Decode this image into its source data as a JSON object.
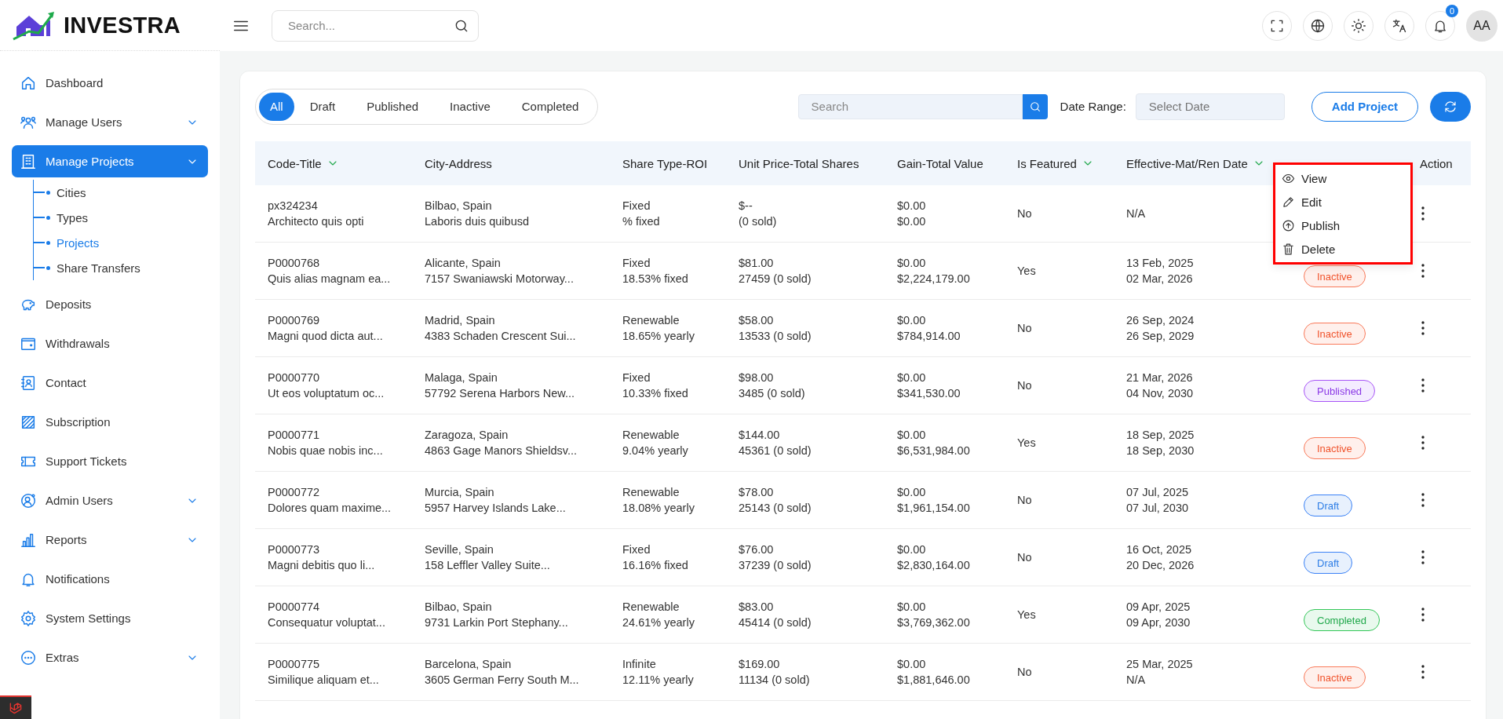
{
  "header": {
    "brand": "INVESTRA",
    "search": {
      "placeholder": "Search..."
    },
    "notifications_count": "0",
    "avatar": "AA"
  },
  "sidebar": {
    "items": [
      {
        "label": "Dashboard",
        "selected": false,
        "has_submenu": false
      },
      {
        "label": "Manage Users",
        "selected": false,
        "has_submenu": true
      },
      {
        "label": "Manage Projects",
        "selected": true,
        "has_submenu": true,
        "children": [
          {
            "label": "Cities",
            "selected": false
          },
          {
            "label": "Types",
            "selected": false
          },
          {
            "label": "Projects",
            "selected": true
          },
          {
            "label": "Share Transfers",
            "selected": false
          }
        ]
      },
      {
        "label": "Deposits",
        "selected": false,
        "has_submenu": false
      },
      {
        "label": "Withdrawals",
        "selected": false,
        "has_submenu": false
      },
      {
        "label": "Contact",
        "selected": false,
        "has_submenu": false
      },
      {
        "label": "Subscription",
        "selected": false,
        "has_submenu": false
      },
      {
        "label": "Support Tickets",
        "selected": false,
        "has_submenu": false
      },
      {
        "label": "Admin Users",
        "selected": false,
        "has_submenu": true
      },
      {
        "label": "Reports",
        "selected": false,
        "has_submenu": true
      },
      {
        "label": "Notifications",
        "selected": false,
        "has_submenu": false
      },
      {
        "label": "System Settings",
        "selected": false,
        "has_submenu": false
      },
      {
        "label": "Extras",
        "selected": false,
        "has_submenu": true
      }
    ]
  },
  "toolbar": {
    "tabs": [
      {
        "label": "All",
        "selected": true
      },
      {
        "label": "Draft",
        "selected": false
      },
      {
        "label": "Published",
        "selected": false
      },
      {
        "label": "Inactive",
        "selected": false
      },
      {
        "label": "Completed",
        "selected": false
      }
    ],
    "search": {
      "placeholder": "Search"
    },
    "date_range_label": "Date Range:",
    "date": {
      "placeholder": "Select Date"
    },
    "add_button": "Add Project"
  },
  "table": {
    "columns": [
      {
        "label": "Code-Title",
        "sortable": true
      },
      {
        "label": "City-Address",
        "sortable": false
      },
      {
        "label": "Share Type-ROI",
        "sortable": false
      },
      {
        "label": "Unit Price-Total Shares",
        "sortable": false
      },
      {
        "label": "Gain-Total Value",
        "sortable": false
      },
      {
        "label": "Is Featured",
        "sortable": true
      },
      {
        "label": "Effective-Mat/Ren Date",
        "sortable": true
      },
      {
        "label": "Action",
        "sortable": false
      }
    ],
    "rows": [
      {
        "cells": [
          [
            "px324234",
            "Architecto quis opti"
          ],
          [
            "Bilbao, Spain",
            "Laboris duis quibusd"
          ],
          [
            "Fixed",
            "% fixed"
          ],
          [
            "$--",
            "(0 sold)"
          ],
          [
            "$0.00",
            "$0.00"
          ],
          [
            "No"
          ],
          [
            "N/A"
          ]
        ]
      },
      {
        "cells": [
          [
            "P0000768",
            "Quis alias magnam ea..."
          ],
          [
            "Alicante, Spain",
            "7157 Swaniawski Motorway..."
          ],
          [
            "Fixed",
            "18.53% fixed"
          ],
          [
            "$81.00",
            "27459 (0 sold)"
          ],
          [
            "$0.00",
            "$2,224,179.00"
          ],
          [
            "Yes"
          ],
          [
            "13 Feb, 2025",
            "02 Mar, 2026"
          ]
        ],
        "status": {
          "label": "Inactive",
          "kind": "inactive"
        }
      },
      {
        "cells": [
          [
            "P0000769",
            "Magni quod dicta aut..."
          ],
          [
            "Madrid, Spain",
            "4383 Schaden Crescent Sui..."
          ],
          [
            "Renewable",
            "18.65% yearly"
          ],
          [
            "$58.00",
            "13533 (0 sold)"
          ],
          [
            "$0.00",
            "$784,914.00"
          ],
          [
            "No"
          ],
          [
            "26 Sep, 2024",
            "26 Sep, 2029"
          ]
        ],
        "status": {
          "label": "Inactive",
          "kind": "inactive"
        }
      },
      {
        "cells": [
          [
            "P0000770",
            "Ut eos voluptatum oc..."
          ],
          [
            "Malaga, Spain",
            "57792 Serena Harbors New..."
          ],
          [
            "Fixed",
            "10.33% fixed"
          ],
          [
            "$98.00",
            "3485 (0 sold)"
          ],
          [
            "$0.00",
            "$341,530.00"
          ],
          [
            "No"
          ],
          [
            "21 Mar, 2026",
            "04 Nov, 2030"
          ]
        ],
        "status": {
          "label": "Published",
          "kind": "published"
        }
      },
      {
        "cells": [
          [
            "P0000771",
            "Nobis quae nobis inc..."
          ],
          [
            "Zaragoza, Spain",
            "4863 Gage Manors Shieldsv..."
          ],
          [
            "Renewable",
            "9.04% yearly"
          ],
          [
            "$144.00",
            "45361 (0 sold)"
          ],
          [
            "$0.00",
            "$6,531,984.00"
          ],
          [
            "Yes"
          ],
          [
            "18 Sep, 2025",
            "18 Sep, 2030"
          ]
        ],
        "status": {
          "label": "Inactive",
          "kind": "inactive"
        }
      },
      {
        "cells": [
          [
            "P0000772",
            "Dolores quam maxime..."
          ],
          [
            "Murcia, Spain",
            "5957 Harvey Islands Lake..."
          ],
          [
            "Renewable",
            "18.08% yearly"
          ],
          [
            "$78.00",
            "25143 (0 sold)"
          ],
          [
            "$0.00",
            "$1,961,154.00"
          ],
          [
            "No"
          ],
          [
            "07 Jul, 2025",
            "07 Jul, 2030"
          ]
        ],
        "status": {
          "label": "Draft",
          "kind": "draft"
        }
      },
      {
        "cells": [
          [
            "P0000773",
            "Magni debitis quo li..."
          ],
          [
            "Seville, Spain",
            "158 Leffler Valley Suite..."
          ],
          [
            "Fixed",
            "16.16% fixed"
          ],
          [
            "$76.00",
            "37239 (0 sold)"
          ],
          [
            "$0.00",
            "$2,830,164.00"
          ],
          [
            "No"
          ],
          [
            "16 Oct, 2025",
            "20 Dec, 2026"
          ]
        ],
        "status": {
          "label": "Draft",
          "kind": "draft"
        }
      },
      {
        "cells": [
          [
            "P0000774",
            "Consequatur voluptat..."
          ],
          [
            "Bilbao, Spain",
            "9731 Larkin Port Stephany..."
          ],
          [
            "Renewable",
            "24.61% yearly"
          ],
          [
            "$83.00",
            "45414 (0 sold)"
          ],
          [
            "$0.00",
            "$3,769,362.00"
          ],
          [
            "Yes"
          ],
          [
            "09 Apr, 2025",
            "09 Apr, 2030"
          ]
        ],
        "status": {
          "label": "Completed",
          "kind": "completed"
        }
      },
      {
        "cells": [
          [
            "P0000775",
            "Similique aliquam et..."
          ],
          [
            "Barcelona, Spain",
            "3605 German Ferry South M..."
          ],
          [
            "Infinite",
            "12.11% yearly"
          ],
          [
            "$169.00",
            "11134 (0 sold)"
          ],
          [
            "$0.00",
            "$1,881,646.00"
          ],
          [
            "No"
          ],
          [
            "25 Mar, 2025",
            "N/A"
          ]
        ],
        "status": {
          "label": "Inactive",
          "kind": "inactive"
        }
      }
    ]
  },
  "action_menu": {
    "items": [
      {
        "label": "View",
        "kind": "view"
      },
      {
        "label": "Edit",
        "kind": "edit"
      },
      {
        "label": "Publish",
        "kind": "publish"
      },
      {
        "label": "Delete",
        "kind": "delete"
      }
    ]
  }
}
